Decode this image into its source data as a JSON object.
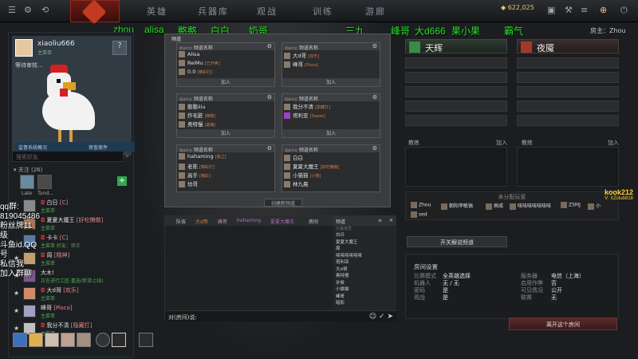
{
  "topbar": {
    "nav": [
      "英雄",
      "兵器库",
      "观战",
      "训练",
      "游廊"
    ],
    "gold": "622,025"
  },
  "player_names": [
    {
      "label": "zhou"
    },
    {
      "label": "alisa"
    },
    {
      "label": "憨憨"
    },
    {
      "label": "白白"
    },
    {
      "label": "奶哥"
    },
    {
      "label": "三九"
    },
    {
      "label": "峰哥"
    },
    {
      "label": "大d666"
    },
    {
      "label": "果小果"
    },
    {
      "label": "霸气"
    }
  ],
  "host_label": "房主：Zhou",
  "profile": {
    "username": "xiaoliu666",
    "level": "主菜单",
    "waiting": "等待审核...",
    "report_label": "监督系统概况",
    "review_label": "审查案件",
    "search_placeholder": "搜索好友",
    "follow_label": "关注 (26)",
    "follow_avatars": [
      "Late",
      "Tund..."
    ]
  },
  "friends": [
    {
      "name": "白日",
      "tag": "[C]",
      "sub": "主菜单"
    },
    {
      "name": "夏夏大魔王",
      "tag": "[好吃懒做]",
      "sub": "主菜单"
    },
    {
      "name": "卡卡",
      "tag": "[C]",
      "sub": "主菜单 好友：师王"
    },
    {
      "name": "周",
      "tag": "[精神]",
      "sub": "主菜单"
    },
    {
      "name": "大木!",
      "tag": "",
      "sub": "正在进行工匠·重选(新游上线)"
    },
    {
      "name": "大d哥",
      "tag": "[欢乐]",
      "sub": "主菜单"
    },
    {
      "name": "峰哥",
      "tag": "[Pisco]",
      "sub": "主菜单"
    },
    {
      "name": "我分不清",
      "tag": "[隐藏打]",
      "sub": "主菜单"
    }
  ],
  "overlay_text": [
    "qq群:",
    "819045486",
    "粉丝牌11级",
    "斗鱼id.QQ号",
    "私信我",
    "加入群聊"
  ],
  "channel_panel": {
    "title": "频道",
    "lang_label": "简体中文",
    "header_label": "频道名称",
    "join_label": "加入",
    "create_label": "创建新频道",
    "cards": [
      {
        "members": [
          {
            "name": "Alisa",
            "tag": ""
          },
          {
            "name": "ReiMu",
            "tag": "[已开卖]"
          },
          {
            "name": "0.0",
            "tag": "[精彩打]"
          }
        ]
      },
      {
        "members": [
          {
            "name": "大d哥",
            "tag": "[欢乐]"
          },
          {
            "name": "峰哥",
            "tag": "[Pisco]"
          }
        ]
      },
      {
        "members": [
          {
            "name": "憨憨iiiu",
            "tag": ""
          },
          {
            "name": "炸毛脏",
            "tag": "[精致]"
          },
          {
            "name": "奥特慢",
            "tag": "[最萌]"
          }
        ]
      },
      {
        "members": [
          {
            "name": "我分不清",
            "tag": "[隐藏打]"
          },
          {
            "name": "塔利亚",
            "tag": "[Sweet]"
          }
        ]
      },
      {
        "members": [
          {
            "name": "hahaming",
            "tag": "[独立]"
          },
          {
            "name": "老陈",
            "tag": "[精彩打]"
          },
          {
            "name": "高手",
            "tag": "[精彩]"
          },
          {
            "name": "坊哥",
            "tag": ""
          }
        ]
      },
      {
        "members": [
          {
            "name": "白白",
            "tag": ""
          },
          {
            "name": "夏夏大魔王",
            "tag": "[好吃懒做]"
          },
          {
            "name": "小猫猫",
            "tag": "[小熊]"
          },
          {
            "name": "林九晨",
            "tag": ""
          }
        ]
      }
    ]
  },
  "chat": {
    "tabs": [
      "队伍",
      "大d哥",
      "峰哥",
      "hahaming",
      "夏夏大魔王",
      "频道",
      "房间"
    ],
    "list_header": "频道",
    "list_sections": [
      {
        "title": "只看成员",
        "items": [
          "白日",
          "夏夏大魔王",
          "周"
        ]
      },
      {
        "title": "",
        "items": [
          "咳咳咳咳咳咳",
          "塔利亚",
          "大d哥",
          "奥特慢",
          "孙俊",
          "小猫猫",
          "峰哥",
          "暗影"
        ]
      }
    ],
    "input_prefix": "对(房间)说:"
  },
  "teams": {
    "radiant": "天辉",
    "dire": "夜魇",
    "coach_label": "教练",
    "join_label": "加入"
  },
  "unassigned": {
    "title": "未分配玩家",
    "players": [
      "Zhou",
      "朝阳李敏镐",
      "佩戚",
      "咳咳咳咳咳咳咳",
      "ZSMJ",
      "小",
      "sed"
    ]
  },
  "open_cast_label": "开关解说频道",
  "room_settings": {
    "title": "房间设置",
    "rows_left": [
      {
        "k": "比赛模式",
        "v": "全英雄选择"
      },
      {
        "k": "机器人",
        "v": "无 / 无"
      },
      {
        "k": "密码",
        "v": "是"
      },
      {
        "k": "观战",
        "v": "是"
      }
    ],
    "rows_right": [
      {
        "k": "服务器",
        "v": "电信（上海）"
      },
      {
        "k": "启用作弊",
        "v": "否"
      },
      {
        "k": "可见情况",
        "v": "公开"
      },
      {
        "k": "联赛",
        "v": "无"
      }
    ]
  },
  "leave_label": "离开这个房间",
  "brand": {
    "line1": "kook212",
    "line2": "V: XZclub818"
  },
  "colors": {
    "accent_green": "#2be02b",
    "gold": "#e8c070"
  }
}
